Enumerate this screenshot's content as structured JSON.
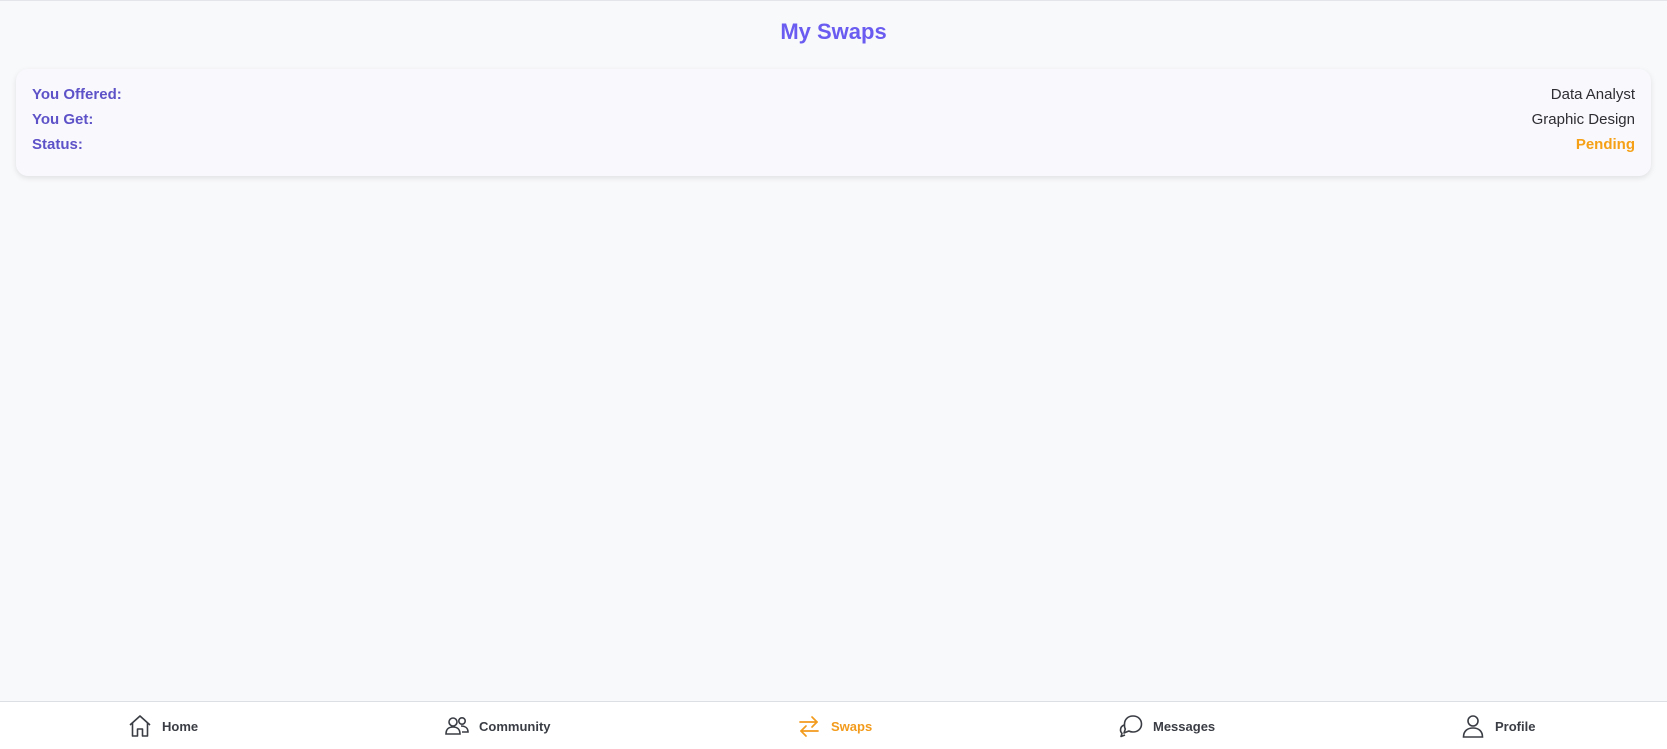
{
  "page": {
    "title": "My Swaps"
  },
  "swap": {
    "offered_label": "You Offered:",
    "offered_value": "Data Analyst",
    "get_label": "You Get:",
    "get_value": "Graphic Design",
    "status_label": "Status:",
    "status_value": "Pending"
  },
  "colors": {
    "accent": "#6a5cf0",
    "label": "#5e52c8",
    "status_pending": "#f5a017",
    "nav_active": "#f29b1c"
  },
  "nav": {
    "items": [
      {
        "label": "Home",
        "icon": "home-icon",
        "active": false
      },
      {
        "label": "Community",
        "icon": "users-icon",
        "active": false
      },
      {
        "label": "Swaps",
        "icon": "swap-arrows-icon",
        "active": true
      },
      {
        "label": "Messages",
        "icon": "chat-icon",
        "active": false
      },
      {
        "label": "Profile",
        "icon": "user-icon",
        "active": false
      }
    ]
  }
}
